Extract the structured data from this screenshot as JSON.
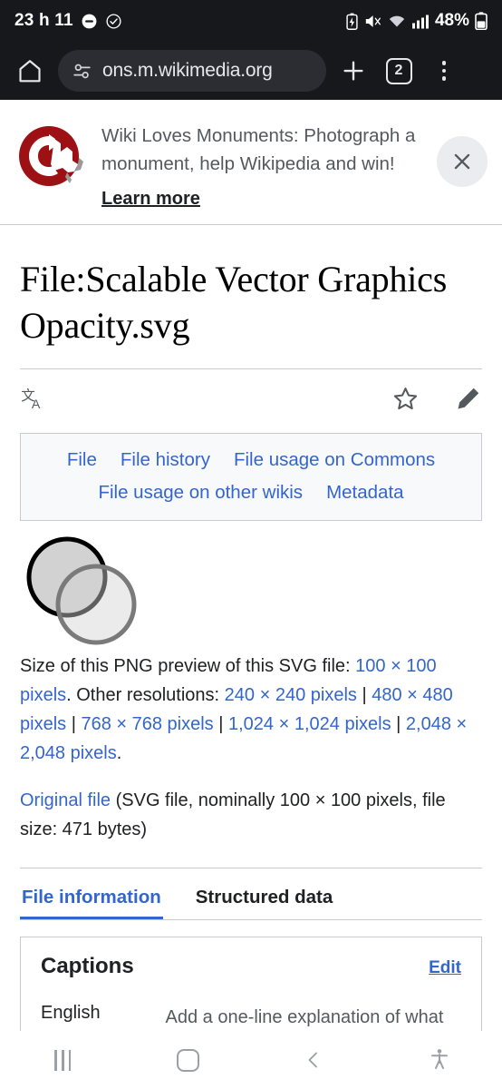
{
  "status_bar": {
    "time": "23 h 11",
    "battery_percent": "48%",
    "icons": [
      "do-not-disturb-icon",
      "check-circle-icon",
      "battery-saver-icon",
      "mute-icon",
      "wifi-icon",
      "signal-icon",
      "battery-icon"
    ]
  },
  "browser": {
    "home_icon": "home-icon",
    "permission_icon": "site-settings-icon",
    "url": "ons.m.wikimedia.org",
    "new_tab_icon": "plus-icon",
    "tab_count": "2",
    "menu_icon": "overflow-menu-icon"
  },
  "banner": {
    "logo": "wiki-loves-monuments-logo",
    "message": "Wiki Loves Monuments: Photograph a monument, help Wikipedia and win!",
    "cta": "Learn more",
    "close_icon": "close-icon"
  },
  "article": {
    "title": "File:Scalable Vector Graphics Opacity.svg",
    "actions": {
      "language_icon": "language-icon",
      "watch_icon": "star-icon",
      "edit_icon": "pencil-icon"
    },
    "toc": [
      "File",
      "File history",
      "File usage on Commons",
      "File usage on other wikis",
      "Metadata"
    ],
    "preview_alt": "two-overlapping-circles-svg-preview",
    "size_line": {
      "lead": "Size of this PNG preview of this SVG file: ",
      "current": "100 × 100 pixels",
      "mid": ". Other resolutions: ",
      "resolutions": [
        "240 × 240 pixels",
        "480 × 480 pixels",
        "768 × 768 pixels",
        "1,024 × 1,024 pixels",
        "2,048 × 2,048 pixels"
      ],
      "separator": " | ",
      "trail": "."
    },
    "original": {
      "link": "Original file",
      "detail": " (SVG file, nominally 100 × 100 pixels, file size: 471 bytes)"
    },
    "tabs": [
      {
        "label": "File information",
        "active": true
      },
      {
        "label": "Structured data",
        "active": false
      }
    ],
    "captions": {
      "heading": "Captions",
      "edit": "Edit",
      "language": "English",
      "placeholder": "Add a one-line explanation of what this file represents"
    }
  },
  "nav_bar": {
    "recents_icon": "recents-icon",
    "home_icon": "home-square-icon",
    "back_icon": "back-chevron-icon",
    "accessibility_icon": "accessibility-icon"
  },
  "colors": {
    "link": "#3366cc",
    "chrome_bg": "#17181c",
    "banner_logo_red": "#9d1014",
    "border": "#c8ccd1"
  }
}
